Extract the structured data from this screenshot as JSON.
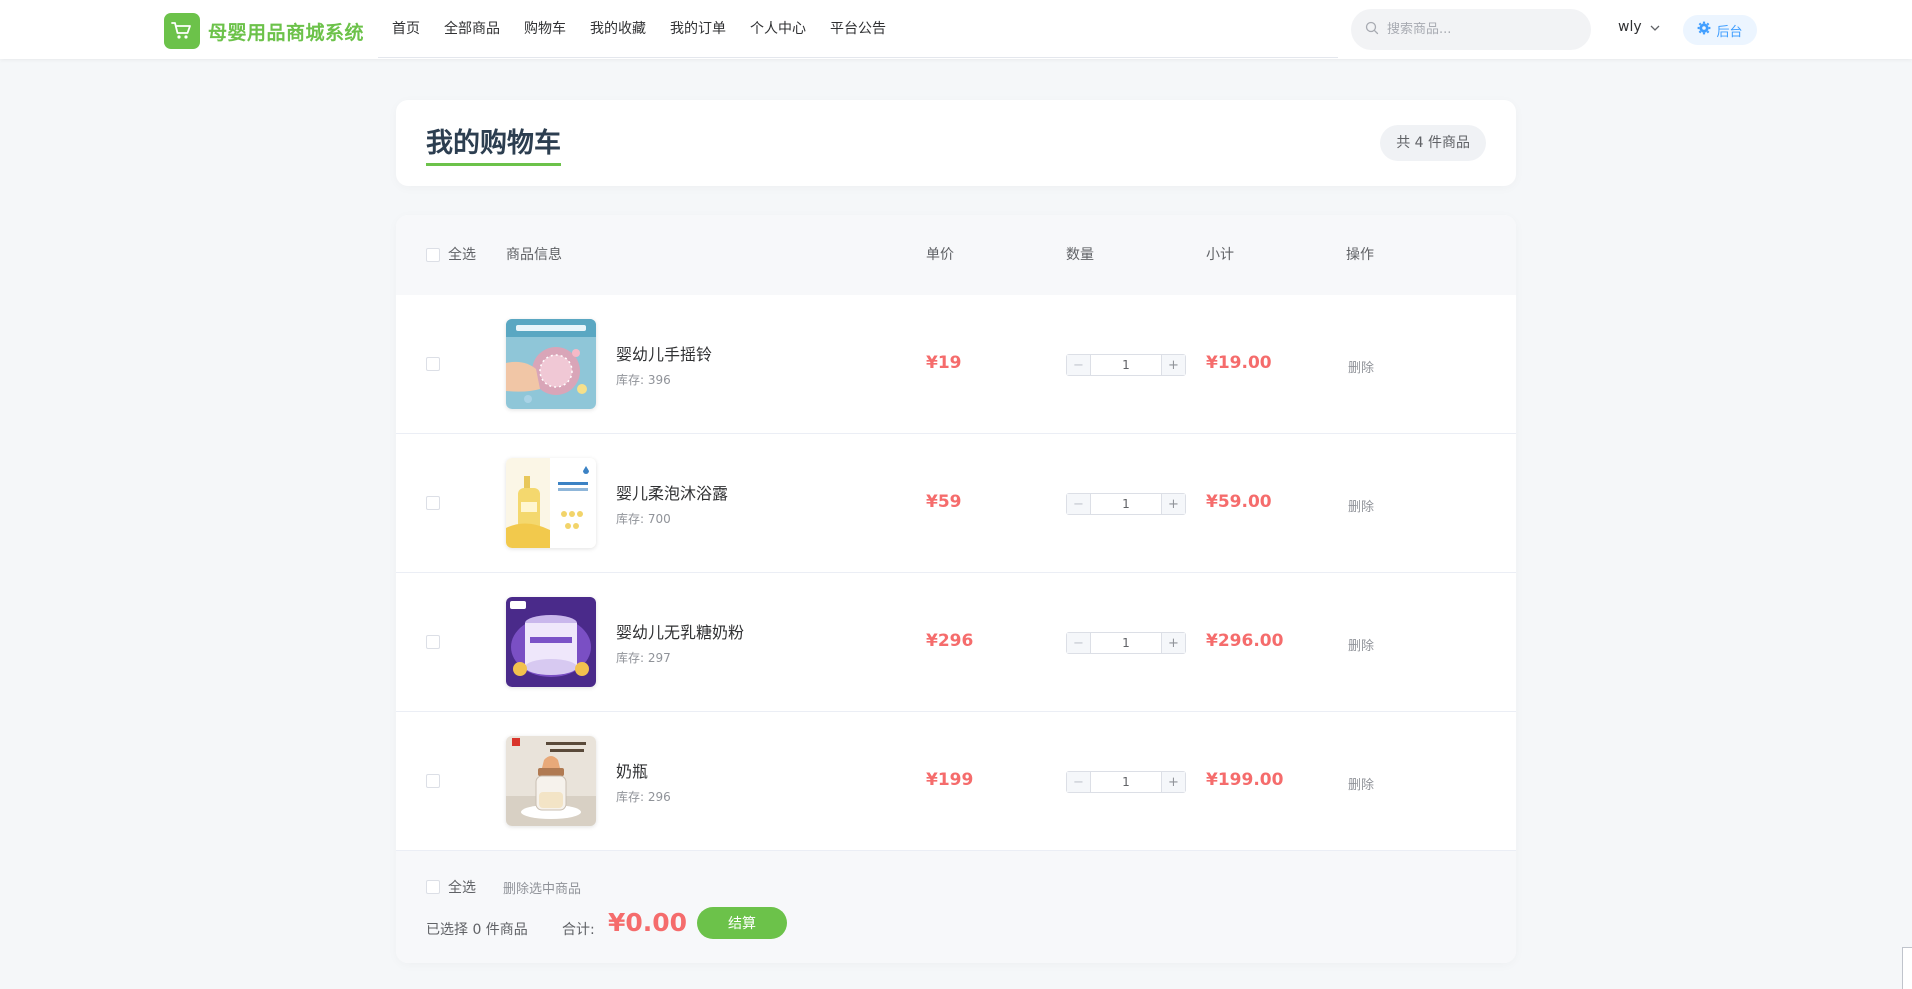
{
  "app": {
    "logo_text": "母婴用品商城系统",
    "brand_color": "#6cc24a",
    "accent_red": "#f56c6c"
  },
  "nav": {
    "items": [
      {
        "label": "首页"
      },
      {
        "label": "全部商品"
      },
      {
        "label": "购物车"
      },
      {
        "label": "我的收藏"
      },
      {
        "label": "我的订单"
      },
      {
        "label": "个人中心"
      },
      {
        "label": "平台公告"
      }
    ]
  },
  "search": {
    "placeholder": "搜索商品..."
  },
  "user": {
    "name": "wly"
  },
  "admin": {
    "label": "后台"
  },
  "page": {
    "title": "我的购物车",
    "count_badge": "共 4 件商品"
  },
  "table": {
    "headers": {
      "select_all": "全选",
      "product": "商品信息",
      "unit_price": "单价",
      "quantity": "数量",
      "subtotal": "小计",
      "action": "操作"
    },
    "rows": [
      {
        "name": "婴幼儿手摇铃",
        "stock": "库存: 396",
        "price": "¥19",
        "qty": "1",
        "subtotal": "¥19.00",
        "action": "删除",
        "minus": "−",
        "plus": "+"
      },
      {
        "name": "婴儿柔泡沐浴露",
        "stock": "库存: 700",
        "price": "¥59",
        "qty": "1",
        "subtotal": "¥59.00",
        "action": "删除",
        "minus": "−",
        "plus": "+"
      },
      {
        "name": "婴幼儿无乳糖奶粉",
        "stock": "库存: 297",
        "price": "¥296",
        "qty": "1",
        "subtotal": "¥296.00",
        "action": "删除",
        "minus": "−",
        "plus": "+"
      },
      {
        "name": "奶瓶",
        "stock": "库存: 296",
        "price": "¥199",
        "qty": "1",
        "subtotal": "¥199.00",
        "action": "删除",
        "minus": "−",
        "plus": "+"
      }
    ]
  },
  "footer": {
    "select_all": "全选",
    "delete_selected": "删除选中商品",
    "selected_text": "已选择 0 件商品",
    "total_label": "合计:",
    "total_value": "¥0.00",
    "checkout_label": "结算"
  }
}
